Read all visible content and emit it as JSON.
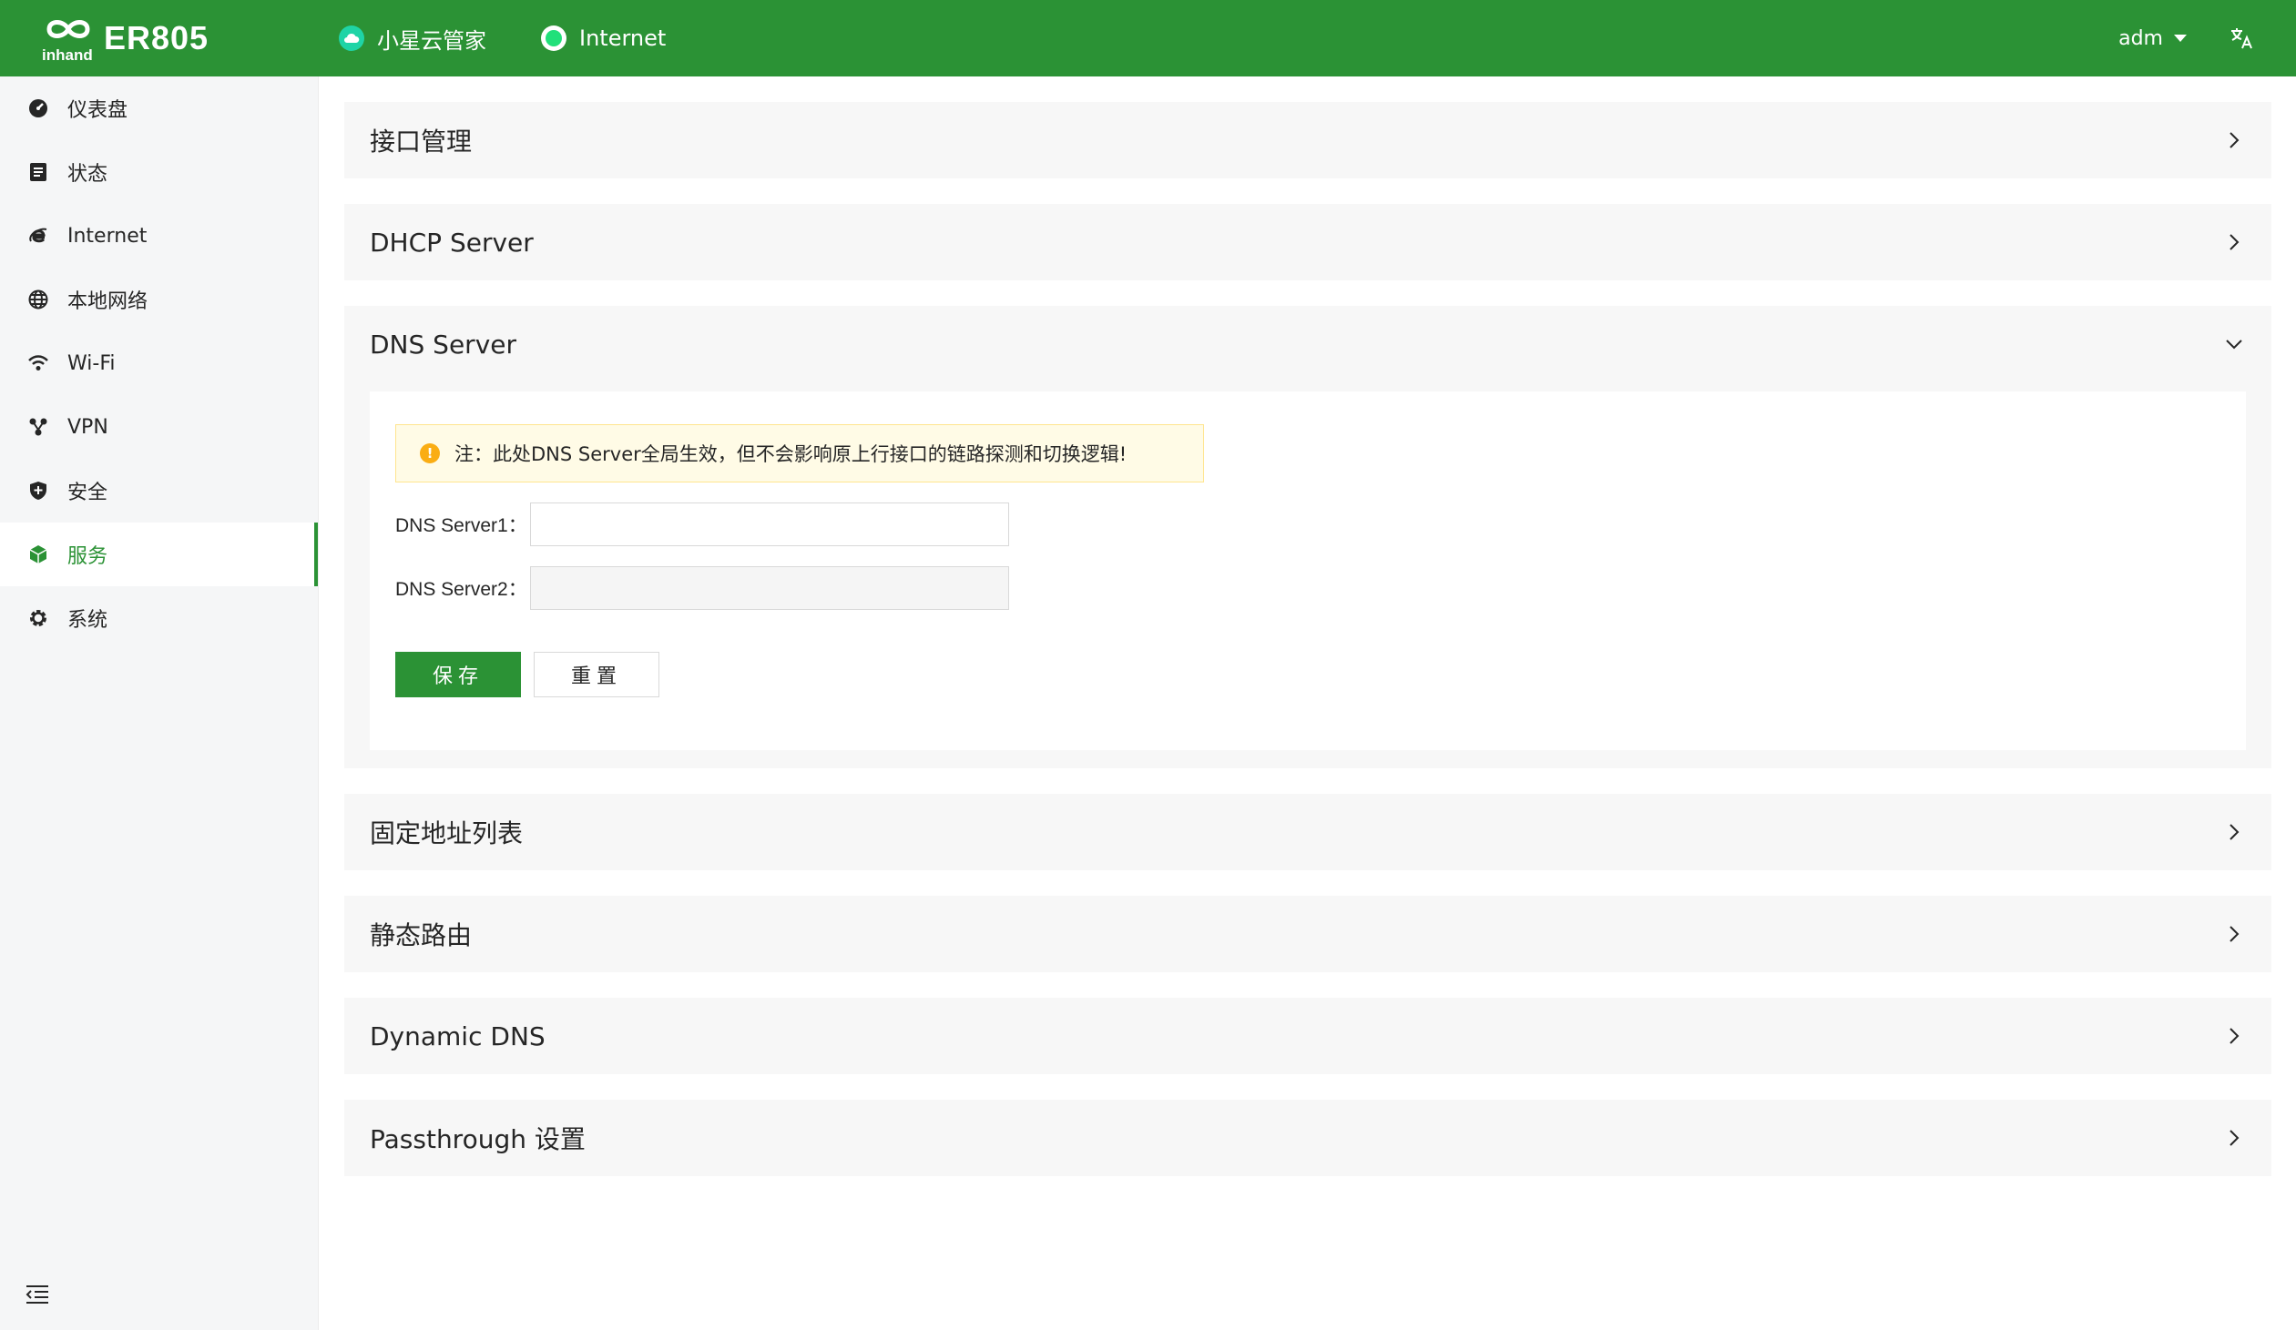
{
  "header": {
    "brand": "ER805",
    "cloud_label": "小星云管家",
    "internet_label": "Internet",
    "user": "adm",
    "colors": {
      "bar": "#2b9235",
      "cloud_dot": "#1fd4a6",
      "internet_dot": "#21e07a"
    }
  },
  "sidebar": {
    "items": [
      {
        "label": "仪表盘",
        "icon": "dashboard-icon"
      },
      {
        "label": "状态",
        "icon": "status-icon"
      },
      {
        "label": "Internet",
        "icon": "internet-icon"
      },
      {
        "label": "本地网络",
        "icon": "globe-icon"
      },
      {
        "label": "Wi-Fi",
        "icon": "wifi-icon"
      },
      {
        "label": "VPN",
        "icon": "vpn-icon"
      },
      {
        "label": "安全",
        "icon": "shield-icon"
      },
      {
        "label": "服务",
        "icon": "cube-icon",
        "active": true
      },
      {
        "label": "系统",
        "icon": "gear-icon"
      }
    ]
  },
  "panels": {
    "interface": {
      "title": "接口管理"
    },
    "dhcp": {
      "title": "DHCP Server"
    },
    "dns": {
      "title": "DNS Server",
      "notice": "注：此处DNS Server全局生效，但不会影响原上行接口的链路探测和切换逻辑!",
      "server1_label": "DNS Server1：",
      "server1_value": "",
      "server2_label": "DNS Server2：",
      "server2_value": "",
      "save_label": "保存",
      "reset_label": "重置"
    },
    "fixed_address": {
      "title": "固定地址列表"
    },
    "static_route": {
      "title": "静态路由"
    },
    "ddns": {
      "title": "Dynamic DNS"
    },
    "passthrough": {
      "title": "Passthrough 设置"
    }
  }
}
